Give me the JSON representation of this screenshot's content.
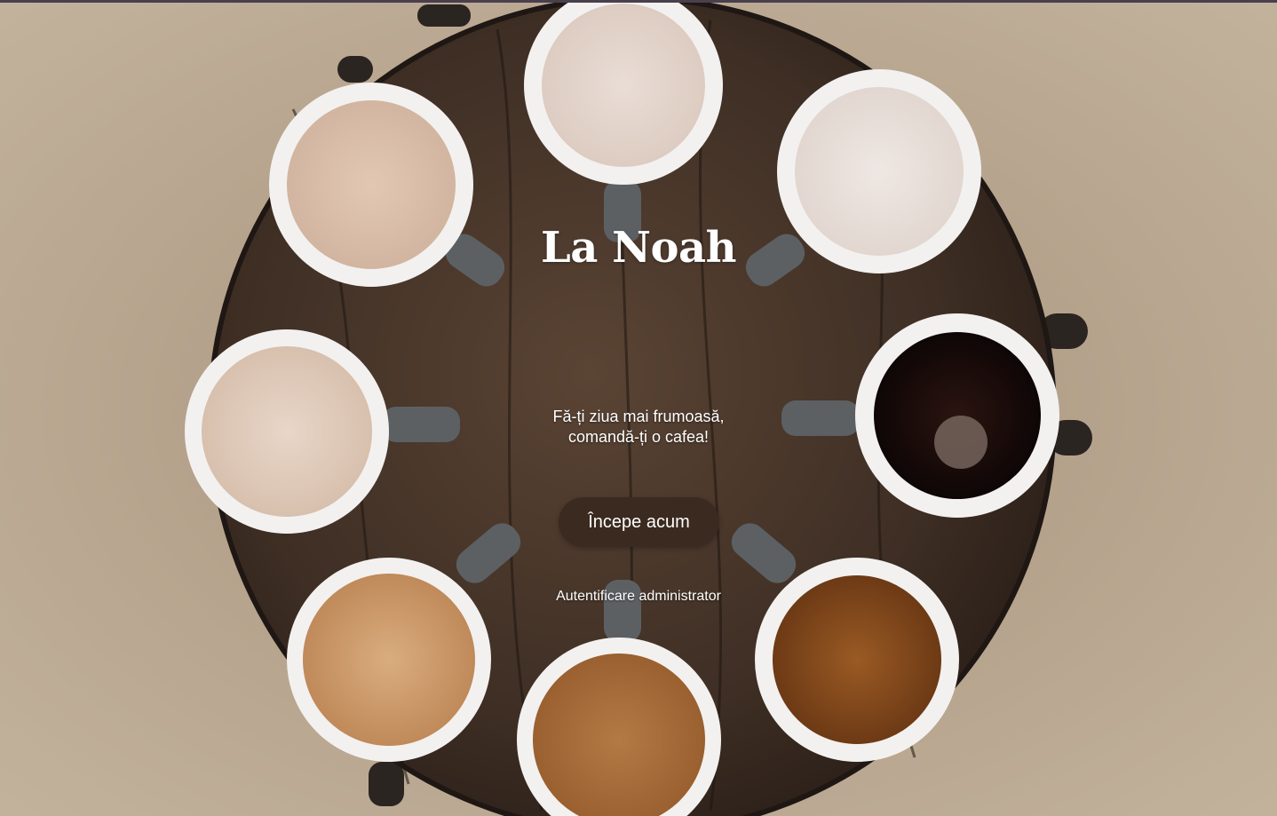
{
  "brand": {
    "title": "La Noah"
  },
  "hero": {
    "tagline_line1": "Fă-ți ziua mai frumoasă,",
    "tagline_line2": "comandă-ți o cafea!",
    "cta_label": "Începe acum",
    "admin_link_label": "Autentificare administrator",
    "background_description_icon": "coffee-cups-photo"
  },
  "colors": {
    "button_bg": "#3b2a1f",
    "text": "#ffffff",
    "top_bar": "#4a3f4d"
  }
}
